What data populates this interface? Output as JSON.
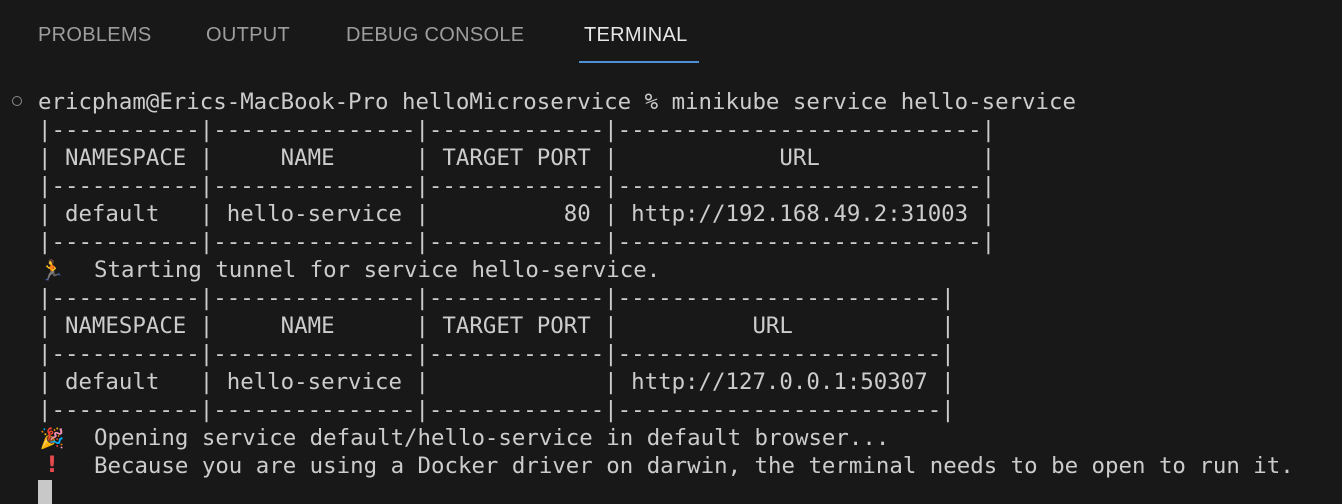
{
  "tabs": [
    {
      "label": "PROBLEMS",
      "active": false
    },
    {
      "label": "OUTPUT",
      "active": false
    },
    {
      "label": "DEBUG CONSOLE",
      "active": false
    },
    {
      "label": "TERMINAL",
      "active": true
    }
  ],
  "colors": {
    "background": "#181818",
    "text": "#cccccc",
    "tab_inactive": "#9d9d9d",
    "tab_active": "#e7e7e7",
    "tab_underline": "#4d8ed6",
    "error_mark": "#e5484d"
  },
  "terminal": {
    "prompt_line": "ericpham@Erics-MacBook-Pro helloMicroservice % minikube service hello-service",
    "table1": [
      "|-----------|---------------|-------------|---------------------------|",
      "| NAMESPACE |     NAME      | TARGET PORT |            URL            |",
      "|-----------|---------------|-------------|---------------------------|",
      "| default   | hello-service |          80 | http://192.168.49.2:31003 |",
      "|-----------|---------------|-------------|---------------------------|"
    ],
    "tunnel_message": "Starting tunnel for service hello-service.",
    "table2": [
      "|-----------|---------------|-------------|------------------------|",
      "| NAMESPACE |     NAME      | TARGET PORT |          URL           |",
      "|-----------|---------------|-------------|------------------------|",
      "| default   | hello-service |             | http://127.0.0.1:50307 |",
      "|-----------|---------------|-------------|------------------------|"
    ],
    "open_message": "Opening service default/hello-service in default browser...",
    "warning_message": "Because you are using a Docker driver on darwin, the terminal needs to be open to run it.",
    "icons": {
      "status": "circle-outline-icon",
      "tunnel": "running-person-icon",
      "open": "party-popper-icon",
      "warning": "exclamation-icon"
    }
  }
}
